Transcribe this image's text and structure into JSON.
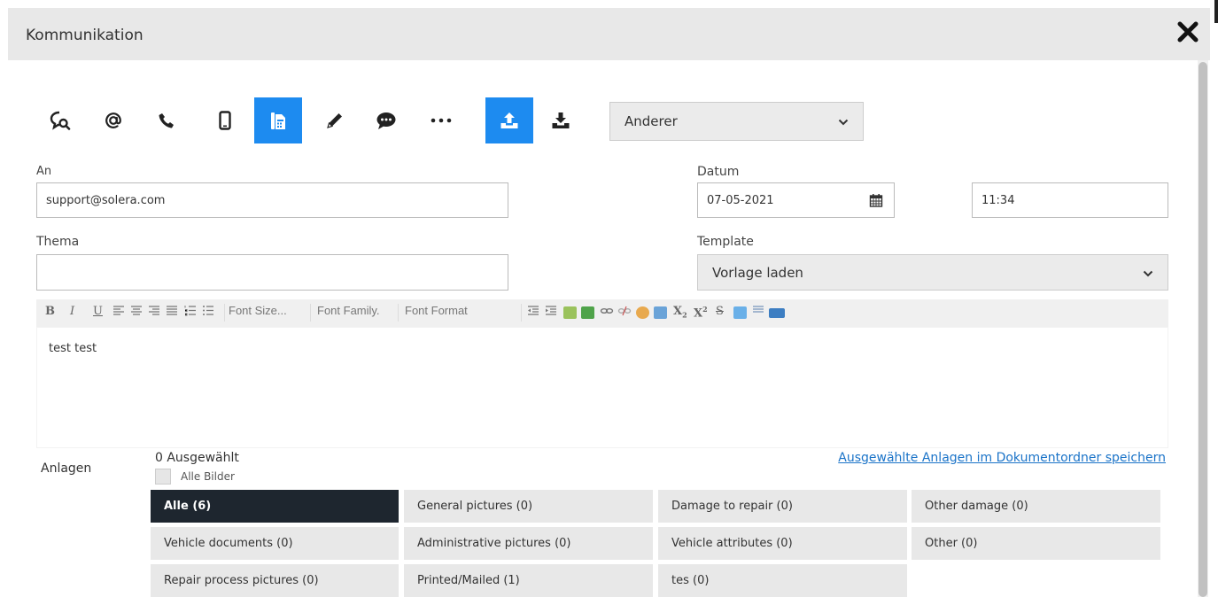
{
  "header": {
    "title": "Kommunikation",
    "close_icon": "close-icon"
  },
  "toolbar": {
    "icons": [
      "chat-search-icon",
      "at-icon",
      "phone-icon",
      "mobile-icon",
      "fax-icon",
      "pencil-icon",
      "comment-icon",
      "more-icon",
      "upload-icon",
      "download-icon"
    ],
    "active": [
      "fax-icon",
      "upload-icon"
    ],
    "accent_color": "#1d8bf0",
    "type_select": "Anderer"
  },
  "form": {
    "to_label": "An",
    "to_value": "support@solera.com",
    "date_label": "Datum",
    "date_value": "07-05-2021",
    "time_value": "11:34",
    "subject_label": "Thema",
    "subject_value": "",
    "template_label": "Template",
    "template_value": "Vorlage laden"
  },
  "editor": {
    "font_size": "Font Size...",
    "font_family": "Font Family.",
    "font_format": "Font Format",
    "body": "test test"
  },
  "attachments": {
    "label": "Anlagen",
    "selected": "0 Ausgewählt",
    "all_images": "Alle Bilder",
    "save_link": "Ausgewählte Anlagen im Dokumentordner speichern",
    "categories": [
      "Alle (6)",
      "General pictures (0)",
      "Damage to repair (0)",
      "Other damage (0)",
      "Vehicle documents (0)",
      "Administrative pictures (0)",
      "Vehicle attributes (0)",
      "Other (0)",
      "Repair process pictures (0)",
      "Printed/Mailed (1)",
      "tes (0)"
    ],
    "active_category": "Alle (6)",
    "active_color": "#1e262f"
  }
}
